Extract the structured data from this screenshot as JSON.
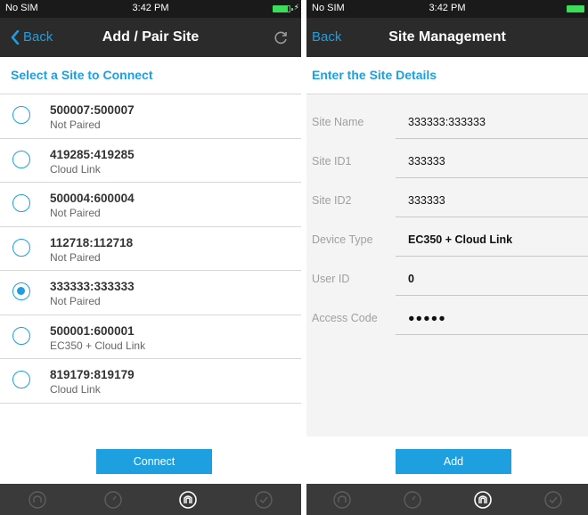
{
  "left_screen": {
    "status_bar": {
      "carrier": "No SIM",
      "time": "3:42 PM",
      "battery_level": 0.9,
      "charging_icon": "bolt"
    },
    "nav": {
      "back_label": "Back",
      "title": "Add / Pair Site",
      "refresh_icon": "refresh-icon"
    },
    "section_title": "Select a Site to Connect",
    "sites": [
      {
        "name": "500007:500007",
        "status": "Not Paired",
        "selected": false
      },
      {
        "name": "419285:419285",
        "status": "Cloud Link",
        "selected": false
      },
      {
        "name": "500004:600004",
        "status": "Not Paired",
        "selected": false
      },
      {
        "name": "112718:112718",
        "status": "Not Paired",
        "selected": false
      },
      {
        "name": "333333:333333",
        "status": "Not Paired",
        "selected": true
      },
      {
        "name": "500001:600001",
        "status": "EC350 + Cloud Link",
        "selected": false
      },
      {
        "name": "819179:819179",
        "status": "Cloud Link",
        "selected": false
      }
    ],
    "connect_label": "Connect",
    "tabs": [
      {
        "icon": "site-icon",
        "active": false
      },
      {
        "icon": "gauge-icon",
        "active": false
      },
      {
        "icon": "pair-icon",
        "active": true
      },
      {
        "icon": "check-icon",
        "active": false
      }
    ]
  },
  "right_screen": {
    "status_bar": {
      "carrier": "No SIM",
      "time": "3:42 PM",
      "battery_level": 1.0
    },
    "nav": {
      "back_label": "Back",
      "title": "Site Management"
    },
    "section_title": "Enter the Site Details",
    "fields": {
      "site_name": {
        "label": "Site Name",
        "value": "333333:333333"
      },
      "site_id1": {
        "label": "Site ID1",
        "value": "333333"
      },
      "site_id2": {
        "label": "Site ID2",
        "value": "333333"
      },
      "device_type": {
        "label": "Device Type",
        "value": "EC350 + Cloud Link"
      },
      "user_id": {
        "label": "User ID",
        "value": "0"
      },
      "access_code": {
        "label": "Access Code",
        "value": "●●●●●"
      }
    },
    "add_label": "Add",
    "tabs": [
      {
        "icon": "site-icon",
        "active": false
      },
      {
        "icon": "gauge-icon",
        "active": false
      },
      {
        "icon": "pair-icon",
        "active": true
      },
      {
        "icon": "check-icon",
        "active": false
      }
    ]
  },
  "colors": {
    "accent": "#1e9fe0",
    "nav_bg": "#2b2b2b",
    "tab_bg": "#3a3a3a",
    "battery": "#3ddc5a"
  }
}
